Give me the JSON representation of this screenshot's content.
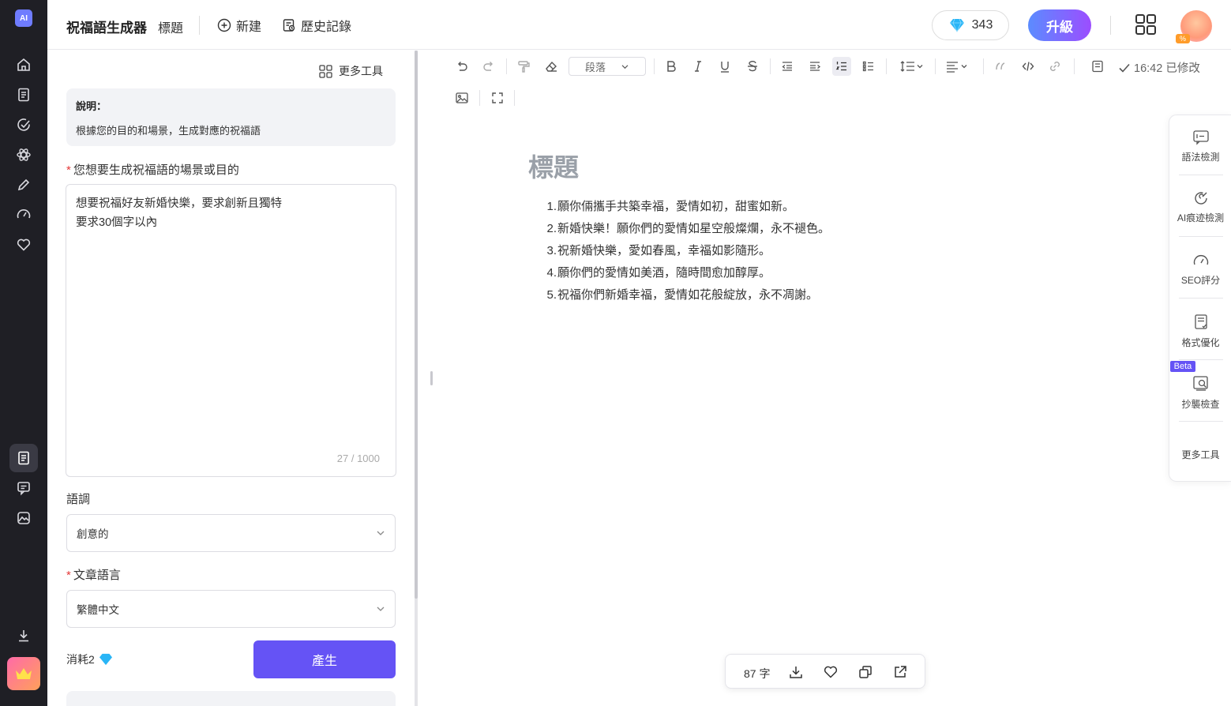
{
  "app": {
    "name": "祝福語生成器",
    "logo_text": "AI"
  },
  "header": {
    "doc_title": "標題",
    "new_label": "新建",
    "history_label": "歷史記錄",
    "gems": "343",
    "upgrade_label": "升級",
    "avatar_badge": "%"
  },
  "form": {
    "more_tools_label": "更多工具",
    "description": {
      "title": "說明：",
      "body": "根據您的目的和場景，生成對應的祝福語"
    },
    "scene_label": "您想要生成祝福語的場景或目的",
    "scene_required": "*",
    "scene_lines": [
      "想要祝福好友新婚快樂，要求創新且獨特",
      "要求30個字以內"
    ],
    "scene_counter": "27 / 1000",
    "tone_label": "語調",
    "tone_value": "創意的",
    "language_label": "文章語言",
    "language_required": "*",
    "language_value": "繁體中文",
    "cost_label": "消耗2",
    "generate_label": "產生"
  },
  "editor": {
    "paragraph_select": "段落",
    "save_status": "16:42 已修改",
    "title": "標題",
    "items": [
      {
        "num": "1.",
        "text": "願你倆攜手共築幸福，愛情如初，甜蜜如新。"
      },
      {
        "num": "2.",
        "text": "新婚快樂！願你們的愛情如星空般燦爛，永不褪色。"
      },
      {
        "num": "3.",
        "text": "祝新婚快樂，愛如春風，幸福如影隨形。"
      },
      {
        "num": "4.",
        "text": "願你們的愛情如美酒，隨時間愈加醇厚。"
      },
      {
        "num": "5.",
        "text": "祝福你們新婚幸福，愛情如花般綻放，永不凋謝。"
      }
    ]
  },
  "right_tools": {
    "grammar": "語法檢測",
    "ai_detect": "AI痕迹檢測",
    "seo": "SEO評分",
    "format": "格式優化",
    "beta": "Beta",
    "plagiarism": "抄襲檢查",
    "more": "更多工具"
  },
  "footer_bar": {
    "word_count": "87 字"
  },
  "colors": {
    "accent": "#6553f5",
    "rail": "#1f1f25",
    "upgrade_start": "#5b8cff",
    "upgrade_end": "#9c4dff"
  }
}
